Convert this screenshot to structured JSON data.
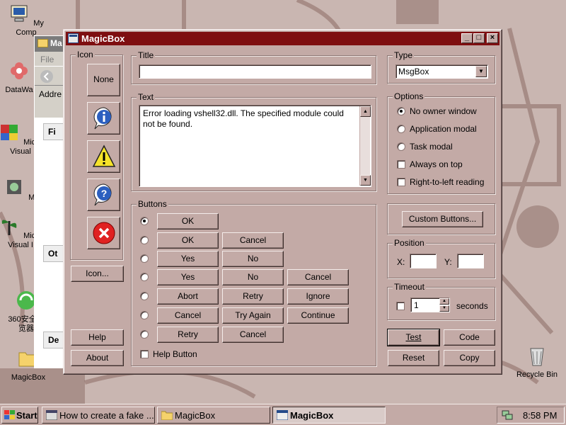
{
  "desktop": {
    "icons": [
      {
        "label": "My Computer",
        "line1": "My",
        "line2": "Comp"
      },
      {
        "label": "DataWa",
        "line1": "DataWa",
        "line2": ""
      },
      {
        "label": "Microsoft Visual",
        "line1": "Micro",
        "line2": "Visual"
      },
      {
        "label": "Myp",
        "line1": "Myp",
        "line2": ""
      },
      {
        "label": "Microsoft Visual",
        "line1": "Micro",
        "line2": "Visual I"
      },
      {
        "label": "360安全浏览器",
        "line1": "360安全浏",
        "line2": "览器"
      },
      {
        "label": "MagicBox",
        "line1": "MagicBox",
        "line2": ""
      },
      {
        "label": "Recycle Bin",
        "line1": "Recycle Bin",
        "line2": ""
      }
    ]
  },
  "bg_window": {
    "title": "Ma",
    "menu": "File",
    "address": "Addre",
    "box1": "Fi",
    "box2": "Ot",
    "box3": "De"
  },
  "dialog": {
    "title": "MagicBox",
    "icon_group": {
      "label": "Icon",
      "none_label": "None",
      "icon_button_label": "Icon..."
    },
    "title_group": {
      "label": "Title",
      "value": ""
    },
    "text_group": {
      "label": "Text",
      "value": "Error loading vshell32.dll. The specified module could not be found."
    },
    "type_group": {
      "label": "Type",
      "selected": "MsgBox"
    },
    "options_group": {
      "label": "Options",
      "items": [
        {
          "label": "No owner window",
          "kind": "radio",
          "checked": true
        },
        {
          "label": "Application modal",
          "kind": "radio",
          "checked": false
        },
        {
          "label": "Task modal",
          "kind": "radio",
          "checked": false
        },
        {
          "label": "Always on top",
          "kind": "check",
          "checked": false
        },
        {
          "label": "Right-to-left reading",
          "kind": "check",
          "checked": false
        }
      ]
    },
    "buttons_group": {
      "label": "Buttons",
      "rows": [
        [
          "OK"
        ],
        [
          "OK",
          "Cancel"
        ],
        [
          "Yes",
          "No"
        ],
        [
          "Yes",
          "No",
          "Cancel"
        ],
        [
          "Abort",
          "Retry",
          "Ignore"
        ],
        [
          "Cancel",
          "Try Again",
          "Continue"
        ],
        [
          "Retry",
          "Cancel"
        ]
      ],
      "selected_row": 0,
      "help_button_label": "Help Button"
    },
    "custom_buttons_label": "Custom Buttons...",
    "position_group": {
      "label": "Position",
      "x_label": "X:",
      "y_label": "Y:",
      "x_value": "",
      "y_value": ""
    },
    "timeout_group": {
      "label": "Timeout",
      "value": "1",
      "unit": "seconds"
    },
    "actions": {
      "test": "Test",
      "code": "Code",
      "reset": "Reset",
      "copy": "Copy",
      "help": "Help",
      "about": "About"
    }
  },
  "taskbar": {
    "start": "Start",
    "items": [
      {
        "label": "How to create a fake ...",
        "active": false
      },
      {
        "label": "MagicBox",
        "active": false
      },
      {
        "label": "MagicBox",
        "active": true
      }
    ],
    "clock": "8:58 PM"
  },
  "colors": {
    "titlebar": "#7e0e10",
    "dialog_face": "#c3aaa6",
    "desktop": "#c5b2ae"
  }
}
